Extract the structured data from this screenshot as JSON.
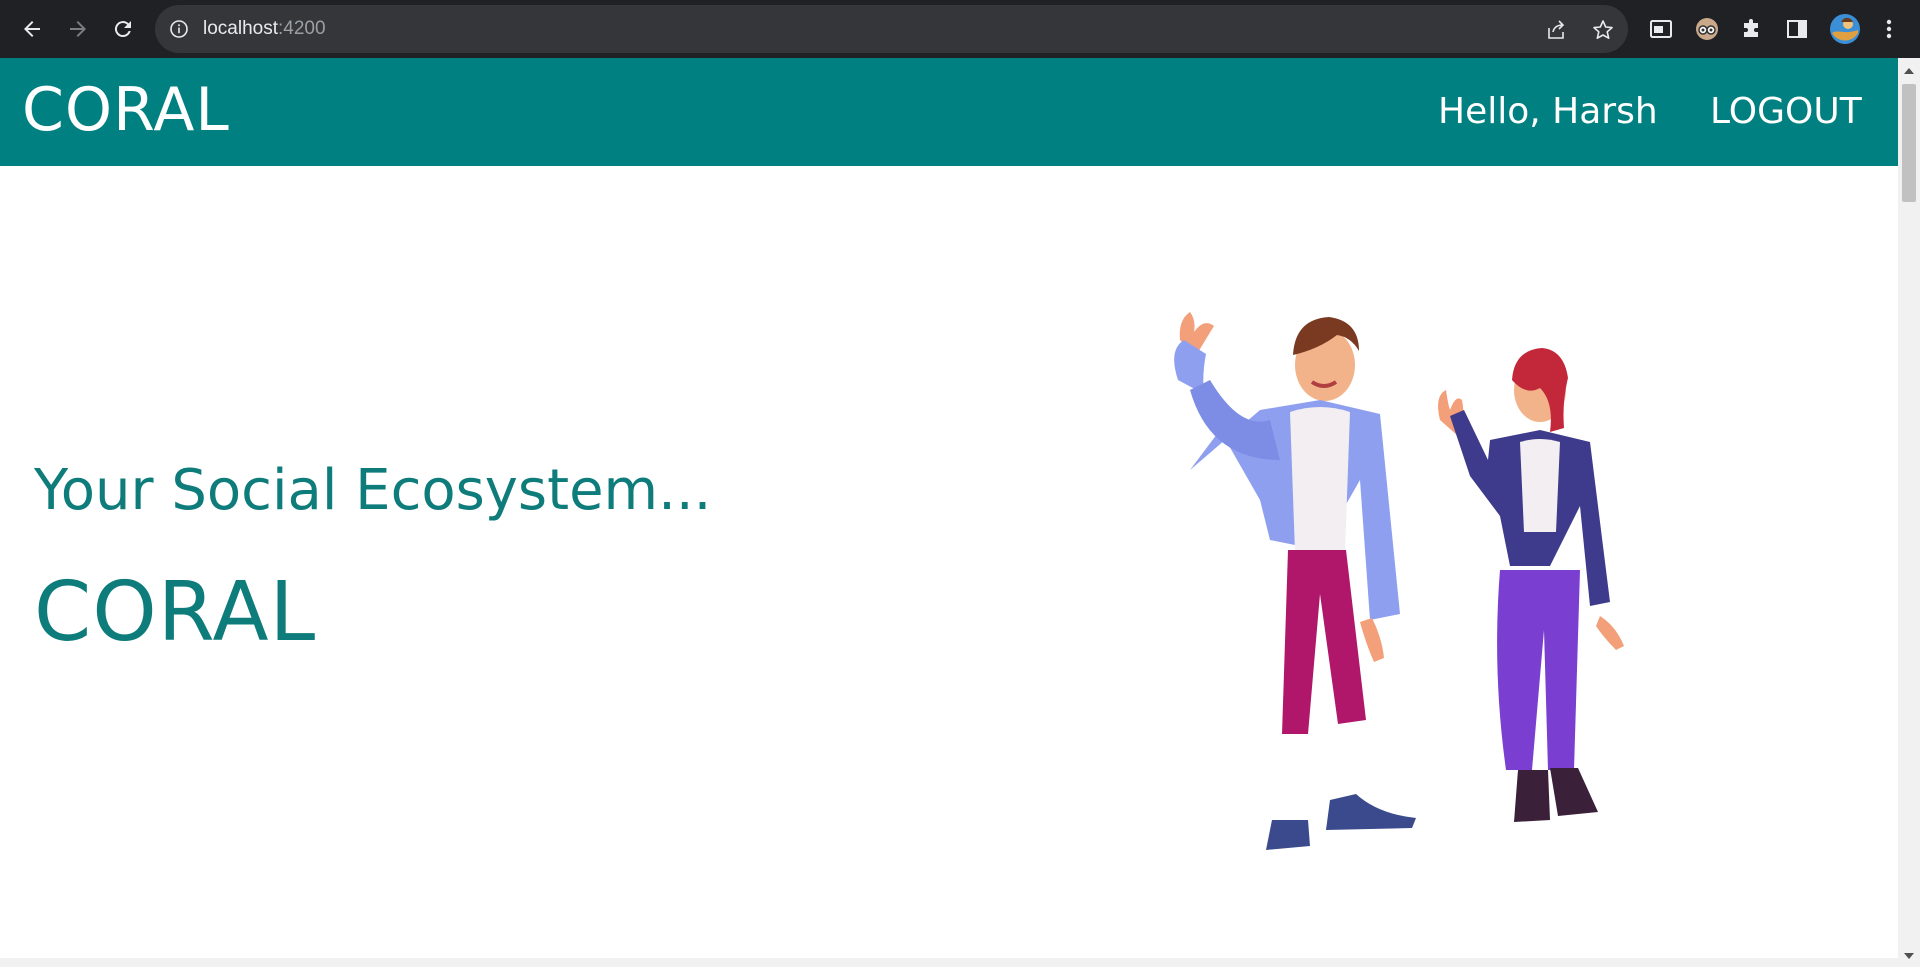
{
  "browser": {
    "url_host": "localhost",
    "url_port": ":4200",
    "icons": [
      "back-icon",
      "forward-icon",
      "reload-icon",
      "info-icon",
      "share-icon",
      "star-icon",
      "media-icon",
      "profile-extension-icon",
      "extensions-icon",
      "side-panel-icon",
      "avatar",
      "menu-icon"
    ]
  },
  "header": {
    "brand": "CORAL",
    "greeting": "Hello, Harsh",
    "logout_label": "LOGOUT"
  },
  "hero": {
    "tagline": "Your Social Ecosystem...",
    "title": "CORAL"
  },
  "colors": {
    "primary": "#008080",
    "heading": "#0e7c7b"
  }
}
